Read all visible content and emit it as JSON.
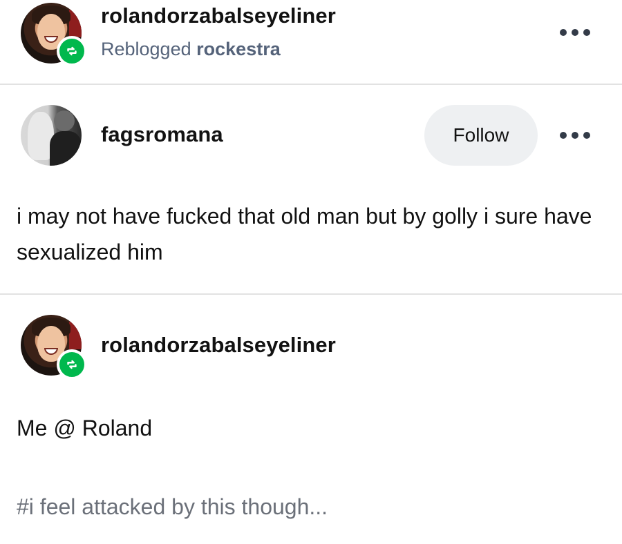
{
  "header": {
    "username": "rolandorzabalseyeliner",
    "reblogged_prefix": "Reblogged",
    "reblogged_from": "rockestra"
  },
  "original_post": {
    "username": "fagsromana",
    "follow_label": "Follow",
    "text": "i may not have fucked that old man but by golly i sure have sexualized him"
  },
  "reply": {
    "username": "rolandorzabalseyeliner",
    "text": "Me @ Roland",
    "tags": "#i feel attacked by this though..."
  },
  "icons": {
    "reblog": "reblog-icon",
    "more": "more-options-icon"
  },
  "colors": {
    "reblog_green": "#00b84d",
    "muted_text": "#55637a",
    "tag_text": "#6b7079"
  }
}
